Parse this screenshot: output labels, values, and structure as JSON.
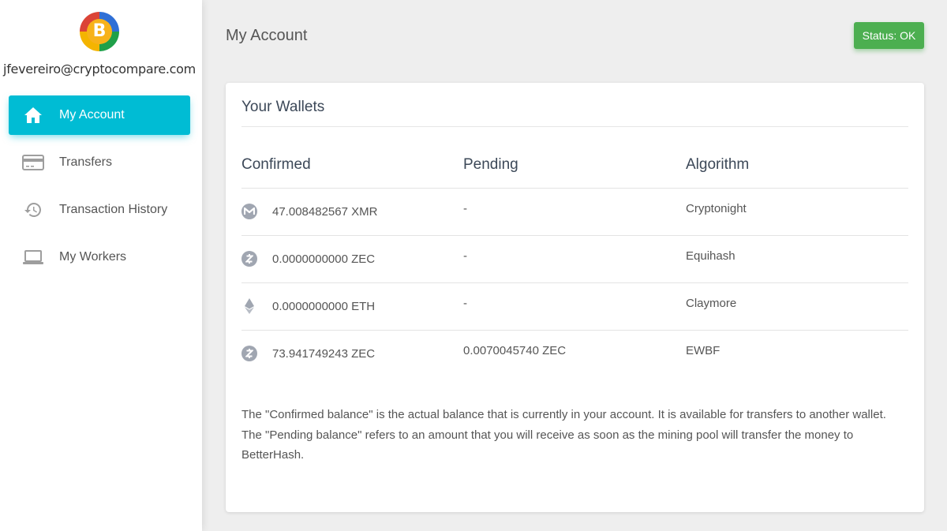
{
  "user": {
    "email": "jfevereiro@cryptocompare.com",
    "logo_letter": "B"
  },
  "sidebar": {
    "items": [
      {
        "label": "My Account",
        "icon": "home-icon",
        "active": true
      },
      {
        "label": "Transfers",
        "icon": "credit-card-icon",
        "active": false
      },
      {
        "label": "Transaction History",
        "icon": "history-icon",
        "active": false
      },
      {
        "label": "My Workers",
        "icon": "laptop-icon",
        "active": false
      }
    ]
  },
  "header": {
    "title": "My Account",
    "status": "Status: OK"
  },
  "wallets": {
    "title": "Your Wallets",
    "columns": [
      "Confirmed",
      "Pending",
      "Algorithm"
    ],
    "rows": [
      {
        "icon": "monero-icon",
        "confirmed": "47.008482567 XMR",
        "pending": "-",
        "algorithm": "Cryptonight"
      },
      {
        "icon": "zcash-icon",
        "confirmed": "0.0000000000 ZEC",
        "pending": "-",
        "algorithm": "Equihash"
      },
      {
        "icon": "ethereum-icon",
        "confirmed": "0.0000000000 ETH",
        "pending": "-",
        "algorithm": "Claymore"
      },
      {
        "icon": "zcash-icon",
        "confirmed": "73.941749243 ZEC",
        "pending": "0.0070045740 ZEC",
        "algorithm": "EWBF"
      }
    ],
    "note": "The \"Confirmed balance\" is the actual balance that is currently in your account. It is available for transfers to another wallet. The \"Pending balance\" refers to an amount that you will receive as soon as the mining pool will transfer the money to BetterHash."
  },
  "colors": {
    "accent": "#00bcd4",
    "status": "#4caf50",
    "icon_gray": "#a0a6b1"
  }
}
